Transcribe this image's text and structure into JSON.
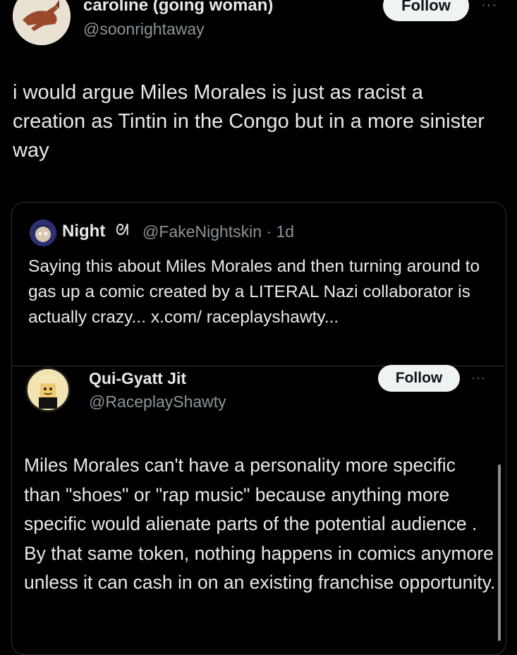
{
  "top_tweet": {
    "display_name": "caroline (going woman)",
    "handle": "@soonrightaway",
    "follow_label": "Follow",
    "more_label": "···",
    "body": "i would argue Miles Morales is just as racist a creation as Tintin in the Congo but in a more sinister way"
  },
  "quoted_tweet": {
    "display_name": "Night",
    "badge": "ᘛ",
    "handle_time": "@FakeNightskin · 1d",
    "body": "Saying this about Miles Morales and then turning around to gas up a comic created by a LITERAL Nazi collaborator is actually crazy... x.com/ raceplayshawty..."
  },
  "embedded_tweet": {
    "display_name": "Qui-Gyatt Jit",
    "handle": "@RaceplayShawty",
    "follow_label": "Follow",
    "more_label": "···",
    "body": "Miles Morales can't have a personality more specific than \"shoes\" or \"rap music\" because anything more specific would alienate parts of the potential audience . By that same token, nothing happens in comics anymore unless it can cash in on an existing franchise opportunity."
  }
}
